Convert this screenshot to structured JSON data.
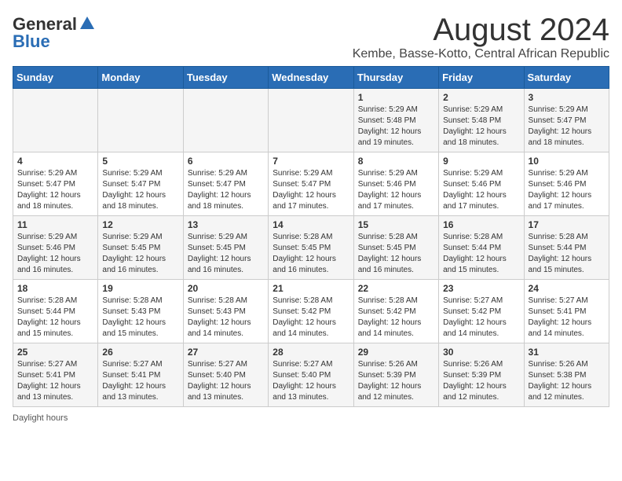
{
  "logo": {
    "general": "General",
    "blue": "Blue"
  },
  "title": "August 2024",
  "subtitle": "Kembe, Basse-Kotto, Central African Republic",
  "footer": "Daylight hours",
  "days_header": [
    "Sunday",
    "Monday",
    "Tuesday",
    "Wednesday",
    "Thursday",
    "Friday",
    "Saturday"
  ],
  "weeks": [
    [
      {
        "day": "",
        "info": ""
      },
      {
        "day": "",
        "info": ""
      },
      {
        "day": "",
        "info": ""
      },
      {
        "day": "",
        "info": ""
      },
      {
        "day": "1",
        "info": "Sunrise: 5:29 AM\nSunset: 5:48 PM\nDaylight: 12 hours and 19 minutes."
      },
      {
        "day": "2",
        "info": "Sunrise: 5:29 AM\nSunset: 5:48 PM\nDaylight: 12 hours and 18 minutes."
      },
      {
        "day": "3",
        "info": "Sunrise: 5:29 AM\nSunset: 5:47 PM\nDaylight: 12 hours and 18 minutes."
      }
    ],
    [
      {
        "day": "4",
        "info": "Sunrise: 5:29 AM\nSunset: 5:47 PM\nDaylight: 12 hours and 18 minutes."
      },
      {
        "day": "5",
        "info": "Sunrise: 5:29 AM\nSunset: 5:47 PM\nDaylight: 12 hours and 18 minutes."
      },
      {
        "day": "6",
        "info": "Sunrise: 5:29 AM\nSunset: 5:47 PM\nDaylight: 12 hours and 18 minutes."
      },
      {
        "day": "7",
        "info": "Sunrise: 5:29 AM\nSunset: 5:47 PM\nDaylight: 12 hours and 17 minutes."
      },
      {
        "day": "8",
        "info": "Sunrise: 5:29 AM\nSunset: 5:46 PM\nDaylight: 12 hours and 17 minutes."
      },
      {
        "day": "9",
        "info": "Sunrise: 5:29 AM\nSunset: 5:46 PM\nDaylight: 12 hours and 17 minutes."
      },
      {
        "day": "10",
        "info": "Sunrise: 5:29 AM\nSunset: 5:46 PM\nDaylight: 12 hours and 17 minutes."
      }
    ],
    [
      {
        "day": "11",
        "info": "Sunrise: 5:29 AM\nSunset: 5:46 PM\nDaylight: 12 hours and 16 minutes."
      },
      {
        "day": "12",
        "info": "Sunrise: 5:29 AM\nSunset: 5:45 PM\nDaylight: 12 hours and 16 minutes."
      },
      {
        "day": "13",
        "info": "Sunrise: 5:29 AM\nSunset: 5:45 PM\nDaylight: 12 hours and 16 minutes."
      },
      {
        "day": "14",
        "info": "Sunrise: 5:28 AM\nSunset: 5:45 PM\nDaylight: 12 hours and 16 minutes."
      },
      {
        "day": "15",
        "info": "Sunrise: 5:28 AM\nSunset: 5:45 PM\nDaylight: 12 hours and 16 minutes."
      },
      {
        "day": "16",
        "info": "Sunrise: 5:28 AM\nSunset: 5:44 PM\nDaylight: 12 hours and 15 minutes."
      },
      {
        "day": "17",
        "info": "Sunrise: 5:28 AM\nSunset: 5:44 PM\nDaylight: 12 hours and 15 minutes."
      }
    ],
    [
      {
        "day": "18",
        "info": "Sunrise: 5:28 AM\nSunset: 5:44 PM\nDaylight: 12 hours and 15 minutes."
      },
      {
        "day": "19",
        "info": "Sunrise: 5:28 AM\nSunset: 5:43 PM\nDaylight: 12 hours and 15 minutes."
      },
      {
        "day": "20",
        "info": "Sunrise: 5:28 AM\nSunset: 5:43 PM\nDaylight: 12 hours and 14 minutes."
      },
      {
        "day": "21",
        "info": "Sunrise: 5:28 AM\nSunset: 5:42 PM\nDaylight: 12 hours and 14 minutes."
      },
      {
        "day": "22",
        "info": "Sunrise: 5:28 AM\nSunset: 5:42 PM\nDaylight: 12 hours and 14 minutes."
      },
      {
        "day": "23",
        "info": "Sunrise: 5:27 AM\nSunset: 5:42 PM\nDaylight: 12 hours and 14 minutes."
      },
      {
        "day": "24",
        "info": "Sunrise: 5:27 AM\nSunset: 5:41 PM\nDaylight: 12 hours and 14 minutes."
      }
    ],
    [
      {
        "day": "25",
        "info": "Sunrise: 5:27 AM\nSunset: 5:41 PM\nDaylight: 12 hours and 13 minutes."
      },
      {
        "day": "26",
        "info": "Sunrise: 5:27 AM\nSunset: 5:41 PM\nDaylight: 12 hours and 13 minutes."
      },
      {
        "day": "27",
        "info": "Sunrise: 5:27 AM\nSunset: 5:40 PM\nDaylight: 12 hours and 13 minutes."
      },
      {
        "day": "28",
        "info": "Sunrise: 5:27 AM\nSunset: 5:40 PM\nDaylight: 12 hours and 13 minutes."
      },
      {
        "day": "29",
        "info": "Sunrise: 5:26 AM\nSunset: 5:39 PM\nDaylight: 12 hours and 12 minutes."
      },
      {
        "day": "30",
        "info": "Sunrise: 5:26 AM\nSunset: 5:39 PM\nDaylight: 12 hours and 12 minutes."
      },
      {
        "day": "31",
        "info": "Sunrise: 5:26 AM\nSunset: 5:38 PM\nDaylight: 12 hours and 12 minutes."
      }
    ]
  ]
}
